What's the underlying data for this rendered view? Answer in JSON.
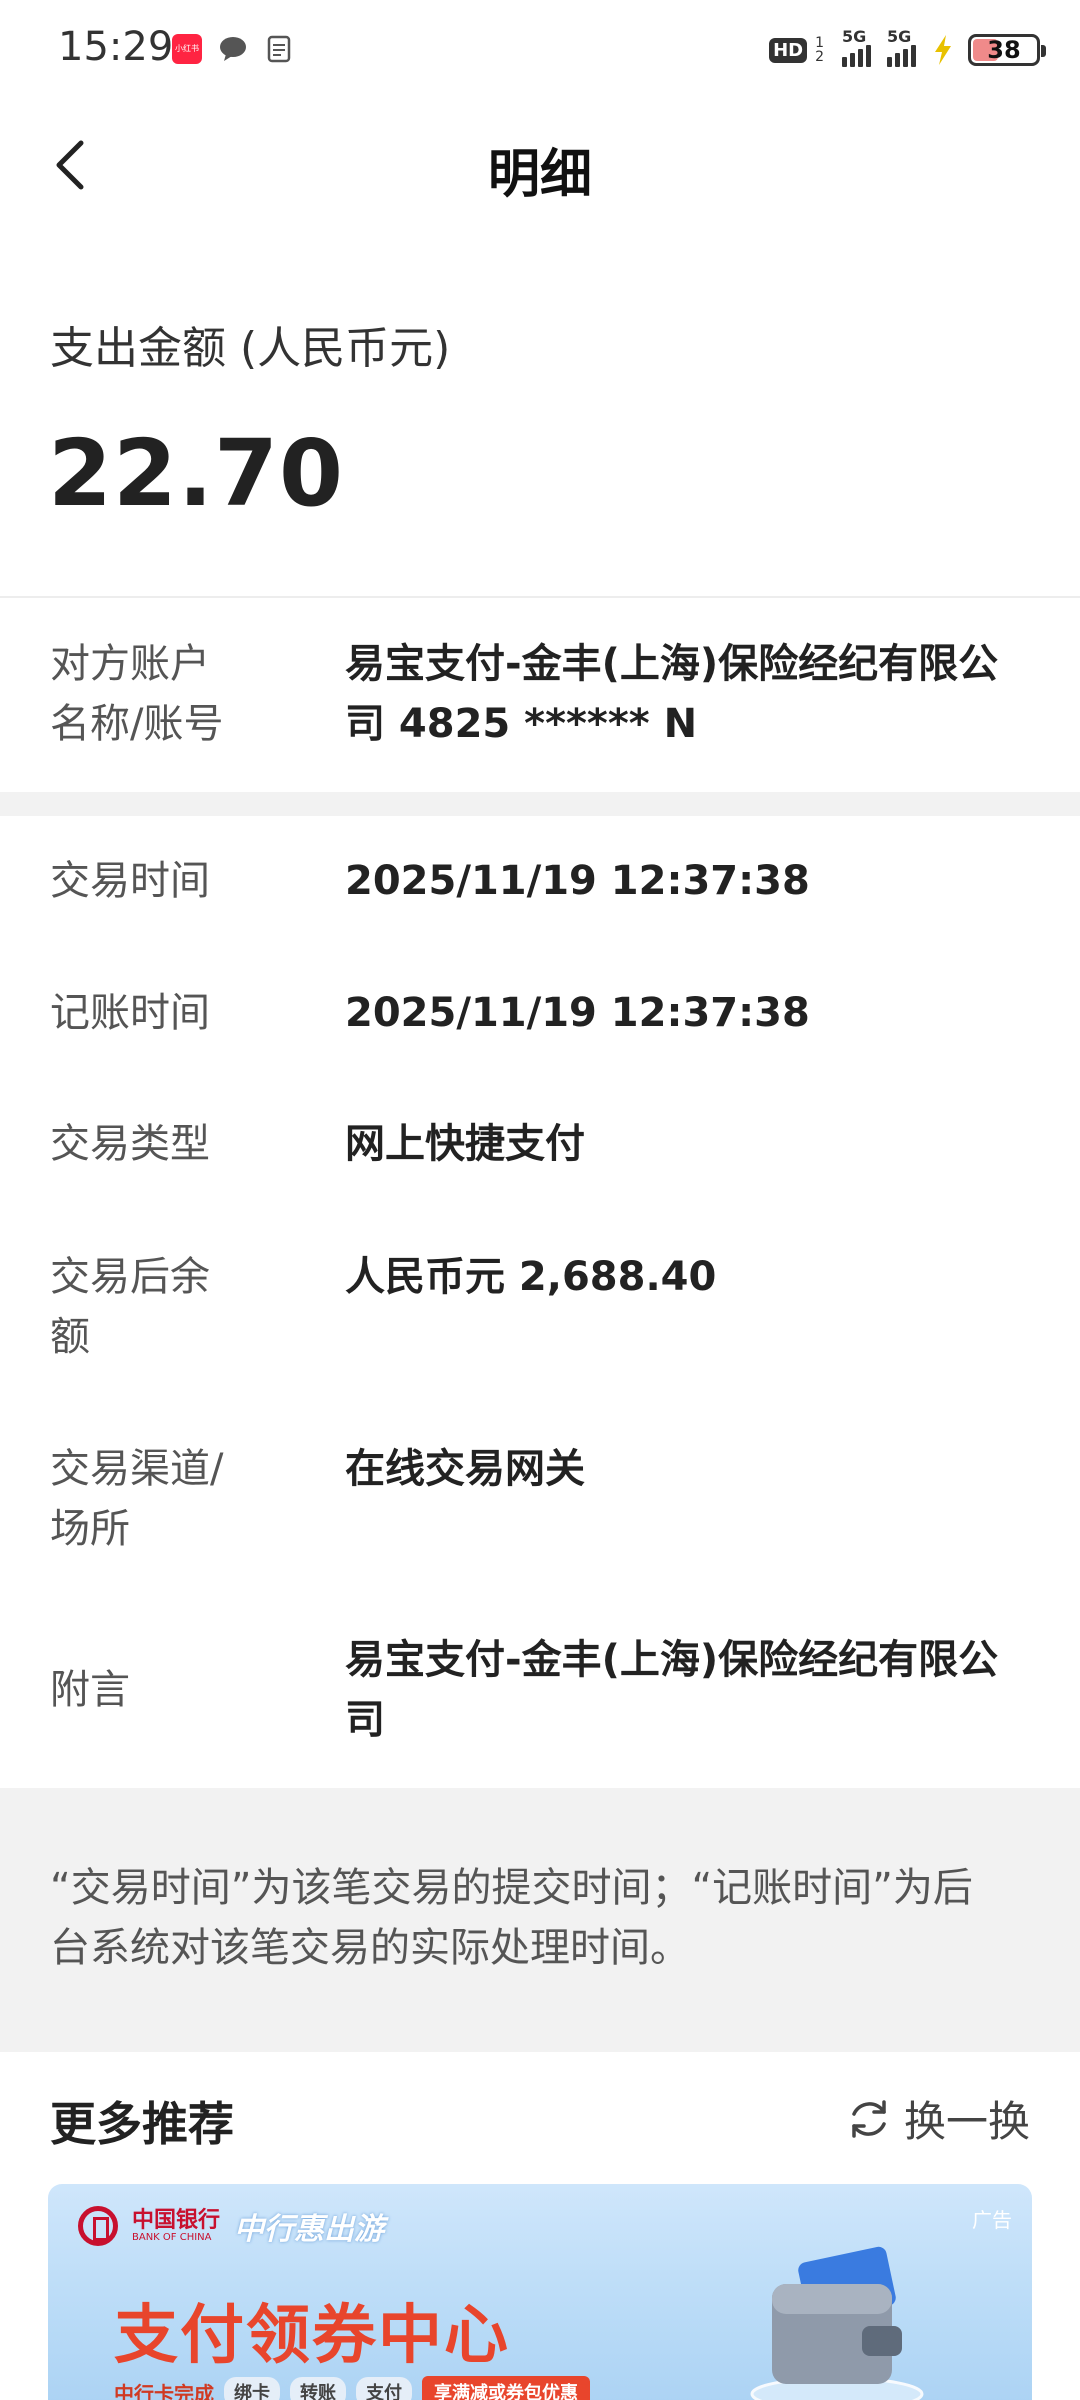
{
  "status_bar": {
    "time": "15:29",
    "redbook_icon": "小红书",
    "hd_label": "HD",
    "hd_top": "1",
    "hd_bottom": "2",
    "sim1": "5G",
    "sim2": "5G",
    "battery": "38"
  },
  "header": {
    "title": "明细",
    "back_icon": "chevron-left-icon"
  },
  "amount": {
    "label": "支出金额 (人民币元)",
    "value": "22.70"
  },
  "counterparty": {
    "label_line1": "对方账户",
    "label_line2": "名称/账号",
    "value_line1": "易宝支付-金丰(上海)保险经纪有限公",
    "value_line2": "司 4825 ****** N"
  },
  "details": [
    {
      "label": "交易时间",
      "value": "2025/11/19 12:37:38"
    },
    {
      "label": "记账时间",
      "value": "2025/11/19 12:37:38"
    },
    {
      "label": "交易类型",
      "value": "网上快捷支付"
    },
    {
      "label": "交易后余额",
      "label_line1": "交易后余",
      "label_line2": "额",
      "value": "人民币元 2,688.40"
    },
    {
      "label_line1": "交易渠道/",
      "label_line2": "场所",
      "value": "在线交易网关"
    },
    {
      "label": "附言",
      "value_line1": "易宝支付-金丰(上海)保险经纪有限公",
      "value_line2": "司"
    }
  ],
  "note": {
    "line1": "“交易时间”为该笔交易的提交时间；“记账时间”为后",
    "line2": "台系统对该笔交易的实际处理时间。"
  },
  "recommend": {
    "title": "更多推荐",
    "refresh_label": "换一换",
    "refresh_icon": "refresh-icon"
  },
  "banner": {
    "bank_name": "中国银行",
    "bank_en": "BANK OF CHINA",
    "slogan": "中行惠出游",
    "ad_tag": "广告",
    "title": "支付领券中心",
    "sub_prefix": "中行卡完成",
    "chip1": "绑卡",
    "chip2": "转账",
    "chip3": "支付",
    "promo": "享满减或券包优惠"
  },
  "colors": {
    "accent_red": "#e8452c",
    "bank_red": "#c8102e",
    "band_gray": "#f2f2f2"
  }
}
